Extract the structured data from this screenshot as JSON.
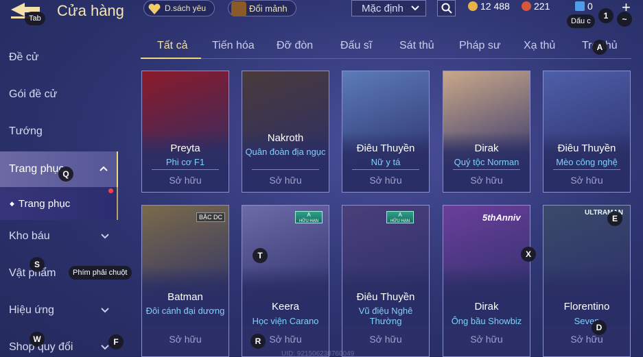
{
  "header": {
    "title": "Cửa hàng",
    "back_key": "Tab",
    "wishlist_label": "D.sách yêu",
    "exchange_label": "Đổi mảnh",
    "sort_value": "Mặc định",
    "gold": "12 488",
    "gems": "221",
    "vouchers": "0",
    "key_1": "1",
    "key_tilde": "~",
    "voucher_label": "Dấu c",
    "plus": "+"
  },
  "sidebar": {
    "items": [
      {
        "label": "Đề cử"
      },
      {
        "label": "Gói đề cử"
      },
      {
        "label": "Tướng"
      },
      {
        "label": "Trang phục"
      },
      {
        "label": "Kho báu"
      },
      {
        "label": "Vật phẩm"
      },
      {
        "label": "Hiệu ứng"
      },
      {
        "label": "Shop quy đổi"
      }
    ],
    "sub_item": "Trang phục",
    "tooltip": "Phím phải chuột"
  },
  "tabs": [
    "Tất cả",
    "Tiến hóa",
    "Đỡ đòn",
    "Đấu sĩ",
    "Sát thủ",
    "Pháp sư",
    "Xạ thủ",
    "Trợ thủ"
  ],
  "owned_label": "Sở hữu",
  "cards": [
    {
      "name": "Preyta",
      "skin": "Phi cơ F1",
      "art": "#8b1a2a"
    },
    {
      "name": "Nakroth",
      "skin": "Quân đoàn địa ngục",
      "art": "#4a3a3a"
    },
    {
      "name": "Điêu Thuyền",
      "skin": "Nữ y tá",
      "art": "#5b7bb8"
    },
    {
      "name": "Dirak",
      "skin": "Quý tộc Norman",
      "art": "#c9a889"
    },
    {
      "name": "Điêu Thuyền",
      "skin": "Mèo công nghệ",
      "art": "#4e5fa8"
    },
    {
      "name": "Batman",
      "skin": "Đôi cánh đại dương",
      "art": "#7a6a4a"
    },
    {
      "name": "Keera",
      "skin": "Học viện Carano",
      "art": "#6d6aa8"
    },
    {
      "name": "Điêu Thuyền",
      "skin": "Vũ điệu Nghê Thường",
      "art": "#4a3f7a"
    },
    {
      "name": "Dirak",
      "skin": "Ông bầu Showbiz",
      "art": "#6b3f9a"
    },
    {
      "name": "Florentino",
      "skin": "Seven",
      "art": "#3a4a6a"
    }
  ],
  "badges": {
    "dc_text": "BẬC DC",
    "a_line1": "A",
    "a_line2": "HỮU HẠN",
    "anniv": "5thAnniv",
    "ultraman": "ULTRAMAN"
  },
  "keys": {
    "q": "Q",
    "a": "A",
    "e": "E",
    "t": "T",
    "x": "X",
    "s": "S",
    "w": "W",
    "f": "F",
    "r": "R",
    "d": "D"
  },
  "uid_text": "UID: 921506238760049"
}
